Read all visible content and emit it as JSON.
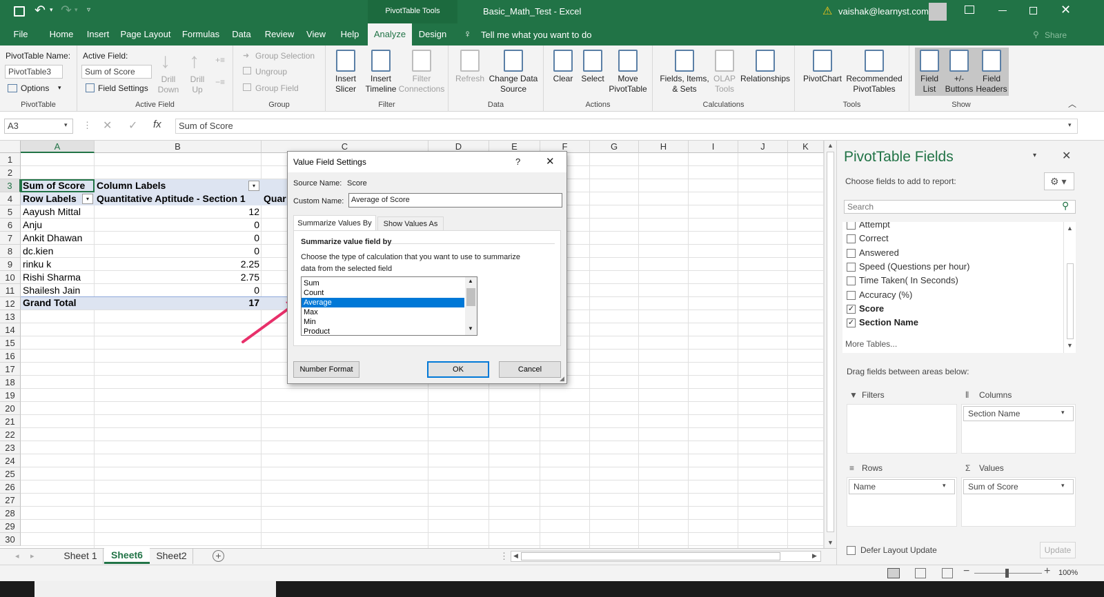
{
  "titlebar": {
    "context_tab": "PivotTable Tools",
    "title": "Basic_Math_Test  -  Excel",
    "user": "vaishak@learnyst.com",
    "share": "Share"
  },
  "tabs": [
    "File",
    "Home",
    "Insert",
    "Page Layout",
    "Formulas",
    "Data",
    "Review",
    "View",
    "Help",
    "Analyze",
    "Design"
  ],
  "tellme": "Tell me what you want to do",
  "ribbon": {
    "pt_name_label": "PivotTable Name:",
    "pt_name_value": "PivotTable3",
    "options": "Options",
    "active_field_label": "Active Field:",
    "active_field_value": "Sum of Score",
    "field_settings": "Field Settings",
    "drill_down": "Drill\nDown",
    "drill_up": "Drill\nUp",
    "group_selection": "Group Selection",
    "ungroup": "Ungroup",
    "group_field": "Group Field",
    "insert_slicer": "Insert\nSlicer",
    "insert_timeline": "Insert\nTimeline",
    "filter_connections": "Filter\nConnections",
    "refresh": "Refresh",
    "change_data_source": "Change Data\nSource",
    "clear": "Clear",
    "select": "Select",
    "move_pivottable": "Move\nPivotTable",
    "fields_items_sets": "Fields, Items,\n& Sets",
    "olap_tools": "OLAP\nTools",
    "relationships": "Relationships",
    "pivotchart": "PivotChart",
    "recommended": "Recommended\nPivotTables",
    "field_list": "Field\nList",
    "buttons": "+/-\nButtons",
    "field_headers": "Field\nHeaders",
    "groups": [
      "PivotTable",
      "Active Field",
      "Group",
      "Filter",
      "Data",
      "Actions",
      "Calculations",
      "Tools",
      "Show"
    ]
  },
  "formula": {
    "namebox": "A3",
    "fx": "fx",
    "content": "Sum of Score"
  },
  "grid": {
    "columns": [
      "A",
      "B",
      "C",
      "D",
      "E",
      "F",
      "G",
      "H",
      "I",
      "J",
      "K"
    ],
    "rows": [
      "1",
      "2",
      "3",
      "4",
      "5",
      "6",
      "7",
      "8",
      "9",
      "10",
      "11",
      "12",
      "13",
      "14",
      "15",
      "16",
      "17",
      "18",
      "19",
      "20",
      "21",
      "22",
      "23",
      "24",
      "25",
      "26",
      "27",
      "28",
      "29",
      "30"
    ],
    "r3a": "Sum of Score",
    "r3b": "Column Labels",
    "r4a": "Row Labels",
    "r4b": "Quantitative Aptitude - Section 1",
    "r4c": "Quar",
    "names": [
      "Aayush Mittal",
      "Anju",
      "Ankit Dhawan",
      "dc.kien",
      "rinku k",
      "Rishi Sharma",
      "Shailesh Jain"
    ],
    "values": [
      "12",
      "0",
      "0",
      "0",
      "2.25",
      "2.75",
      "0"
    ],
    "grand_total_label": "Grand Total",
    "grand_total_value": "17"
  },
  "sheets": [
    "Sheet 1",
    "Sheet6",
    "Sheet2"
  ],
  "zoom": "100%",
  "pane": {
    "title": "PivotTable Fields",
    "choose": "Choose fields to add to report:",
    "search_placeholder": "Search",
    "fields": [
      {
        "label": "Attempt",
        "checked": false
      },
      {
        "label": "Correct",
        "checked": false
      },
      {
        "label": "Answered",
        "checked": false
      },
      {
        "label": "Speed (Questions per hour)",
        "checked": false
      },
      {
        "label": "Time Taken( In Seconds)",
        "checked": false
      },
      {
        "label": "Accuracy (%)",
        "checked": false
      },
      {
        "label": "Score",
        "checked": true
      },
      {
        "label": "Section Name",
        "checked": true
      }
    ],
    "more_tables": "More Tables...",
    "drag_text": "Drag fields between areas below:",
    "filters": "Filters",
    "columns": "Columns",
    "rows": "Rows",
    "values": "Values",
    "columns_item": "Section Name",
    "rows_item": "Name",
    "values_item": "Sum of Score",
    "defer": "Defer Layout Update",
    "update": "Update"
  },
  "dialog": {
    "title": "Value Field Settings",
    "help": "?",
    "source_label": "Source Name:",
    "source_value": "Score",
    "custom_label": "Custom Name:",
    "custom_value": "Average of Score",
    "tab1": "Summarize Values By",
    "tab2": "Show Values As",
    "section": "Summarize value field by",
    "desc1": "Choose the type of calculation that you want to use to summarize",
    "desc2": "data from the selected field",
    "list": [
      "Sum",
      "Count",
      "Average",
      "Max",
      "Min",
      "Product"
    ],
    "selected": "Average",
    "number_format": "Number Format",
    "ok": "OK",
    "cancel": "Cancel"
  },
  "colors": {
    "excel_green": "#217346",
    "selection_blue": "#0078d7",
    "pivot_header": "#dde4f1",
    "arrow": "#e8306a"
  }
}
